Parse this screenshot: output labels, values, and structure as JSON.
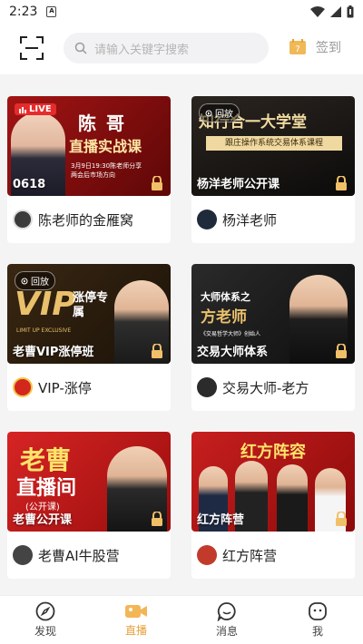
{
  "status_bar": {
    "time": "2:23",
    "sim_label": "A"
  },
  "search": {
    "placeholder": "请输入关键字搜索"
  },
  "checkin": {
    "label": "签到"
  },
  "cards": [
    {
      "badge": "LIVE",
      "title_line1": "陈 哥",
      "title_line2": "直播实战课",
      "small_text": "3月9日19:30陈老师分享",
      "small_text2": "两会后市场方向",
      "caption": "0618",
      "name": "陈老师的金雁窝"
    },
    {
      "badge": "回放",
      "title_line1": "知行合一大学堂",
      "title_line2": "跟庄操作系统交易体系课程",
      "caption": "杨洋老师公开课",
      "name": "杨洋老师"
    },
    {
      "badge": "回放",
      "title_line1": "VIP",
      "title_line2": "涨停专属",
      "small_text": "LIMIT UP EXCLUSIVE",
      "caption": "老曹VIP涨停班",
      "name": "VIP-涨停"
    },
    {
      "badge": "",
      "title_line1": "大师体系之",
      "title_line2": "方老师",
      "small_text": "《交易哲学大师》创始人",
      "caption": "交易大师体系",
      "name": "交易大师-老方"
    },
    {
      "badge": "",
      "title_line1": "老曹",
      "title_line2": "直播间",
      "small_text": "(公开课)",
      "caption": "老曹公开课",
      "name": "老曹AI牛股营"
    },
    {
      "badge": "",
      "title_line1": "红方阵容",
      "caption": "红方阵营",
      "name": "红方阵营"
    }
  ],
  "tabs": [
    {
      "label": "发现",
      "icon": "compass-icon"
    },
    {
      "label": "直播",
      "icon": "video-camera-icon"
    },
    {
      "label": "消息",
      "icon": "chat-bubble-icon"
    },
    {
      "label": "我",
      "icon": "smile-face-icon"
    }
  ],
  "colors": {
    "accent": "#e6a13a",
    "live_red": "#e62b2b"
  }
}
